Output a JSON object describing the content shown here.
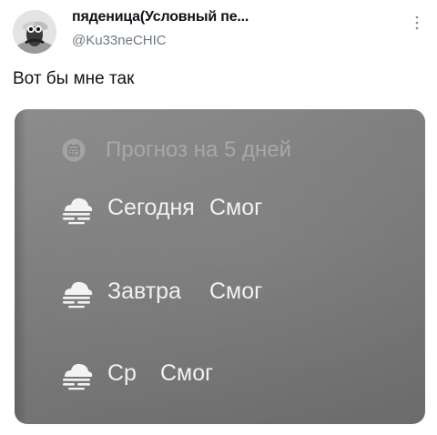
{
  "tweet": {
    "author_name": "пяденица(Условный пе...",
    "author_handle": "@Ku33neCHIC",
    "text": "Вот бы мне так",
    "more_icon": "more-vertical-icon"
  },
  "widget": {
    "header_icon": "calendar-icon",
    "title": "Прогноз на 5 дней",
    "rows": [
      {
        "day": "Сегодня",
        "condition": "Смог",
        "icon": "fog-icon"
      },
      {
        "day": "Завтра",
        "condition": "Смог",
        "icon": "fog-icon"
      },
      {
        "day": "Ср",
        "condition": "Смог",
        "icon": "fog-icon"
      }
    ]
  }
}
